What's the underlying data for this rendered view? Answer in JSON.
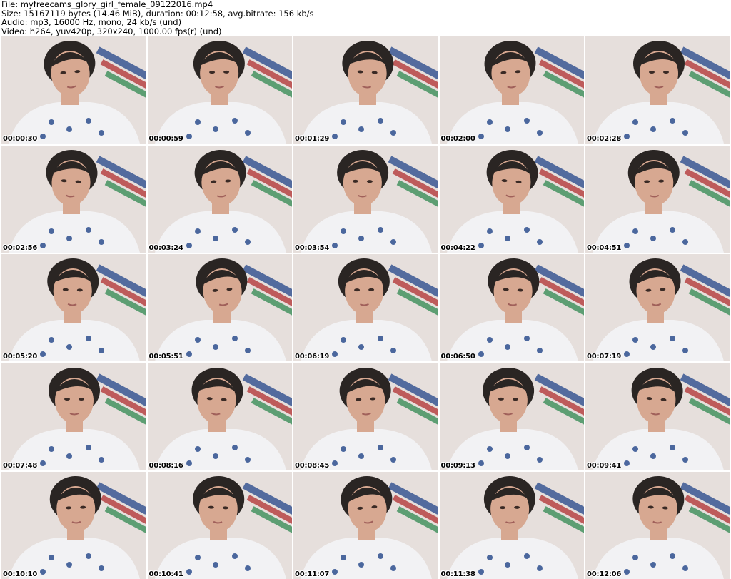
{
  "header": {
    "file_line": "File: myfreecams_glory_girl_female_09122016.mp4",
    "size_line": "Size: 15167119 bytes (14.46 MiB), duration: 00:12:58, avg.bitrate: 156 kb/s",
    "audio_line": "Audio: mp3, 16000 Hz, mono, 24 kb/s (und)",
    "video_line": "Video: h264, yuv420p, 320x240, 1000.00 fps(r) (und)"
  },
  "thumbnails": [
    {
      "time": "00:00:30"
    },
    {
      "time": "00:00:59"
    },
    {
      "time": "00:01:29"
    },
    {
      "time": "00:02:00"
    },
    {
      "time": "00:02:28"
    },
    {
      "time": "00:02:56"
    },
    {
      "time": "00:03:24"
    },
    {
      "time": "00:03:54"
    },
    {
      "time": "00:04:22"
    },
    {
      "time": "00:04:51"
    },
    {
      "time": "00:05:20"
    },
    {
      "time": "00:05:51"
    },
    {
      "time": "00:06:19"
    },
    {
      "time": "00:06:50"
    },
    {
      "time": "00:07:19"
    },
    {
      "time": "00:07:48"
    },
    {
      "time": "00:08:16"
    },
    {
      "time": "00:08:45"
    },
    {
      "time": "00:09:13"
    },
    {
      "time": "00:09:41"
    },
    {
      "time": "00:10:10"
    },
    {
      "time": "00:10:41"
    },
    {
      "time": "00:11:07"
    },
    {
      "time": "00:11:38"
    },
    {
      "time": "00:12:06"
    }
  ],
  "colors": {
    "background": "#ffffff",
    "wall": "#e6dfdc",
    "shirt": "#f2f2f4",
    "hair": "#2a2523",
    "skin": "#d7a891",
    "print": "#2f4f8f"
  }
}
